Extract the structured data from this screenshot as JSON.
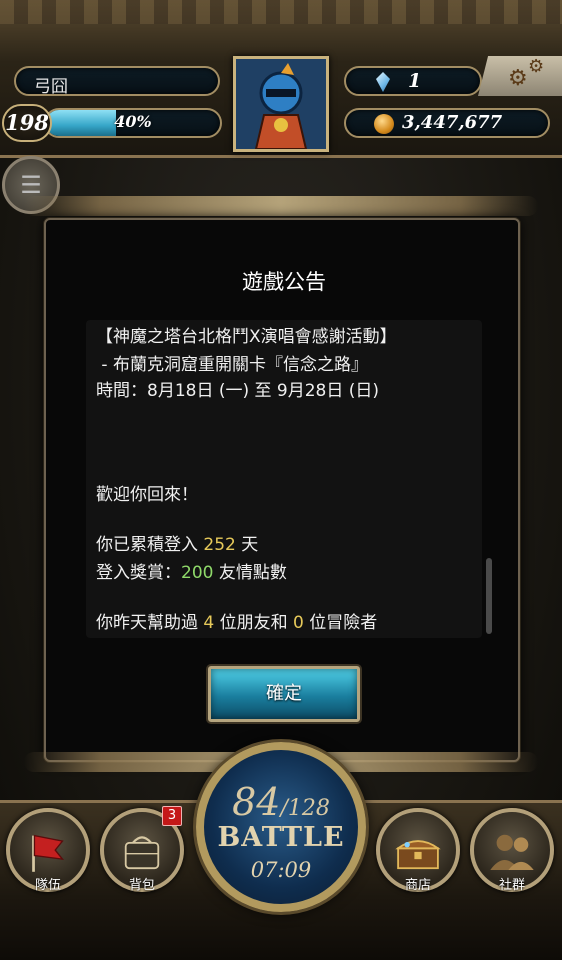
{
  "player": {
    "name": "弓囧",
    "level": "198",
    "exp_percent_label": "40%",
    "exp_fraction": 0.4,
    "gems": "1",
    "gold": "3,447,677"
  },
  "icons": {
    "settings": "gears-icon",
    "tab": "notice-tab-icon",
    "gem": "diamond-icon",
    "gold": "coin-icon"
  },
  "dialog": {
    "title": "遊戲公告",
    "lines": {
      "l1": "【神魔之塔台北格鬥X演唱會感謝活動】",
      "l2": " - 布蘭克洞窟重開關卡『信念之路』",
      "l3": "時間：8月18日 (一) 至 9月28日 (日)",
      "l4": "歡迎你回來！",
      "l5_prefix": "你已累積登入 ",
      "l5_value": "252",
      "l5_suffix": " 天",
      "l6_prefix": "登入獎賞：",
      "l6_value": "200",
      "l6_suffix": " 友情點數",
      "l7_prefix": "你昨天幫助過 ",
      "l7_value1": "4",
      "l7_mid": " 位朋友和 ",
      "l7_value2": "0",
      "l7_suffix": " 位冒險者"
    },
    "ok_label": "確定"
  },
  "nav": {
    "team": "隊伍",
    "bag": "背包",
    "bag_badge": "3",
    "shop": "商店",
    "social": "社群",
    "stamina_current": "84",
    "stamina_max": "/128",
    "battle": "BATTLE",
    "timer": "07:09"
  },
  "colors": {
    "highlight_yellow": "#e6c95a",
    "highlight_green": "#8fd96a",
    "button_cyan": "#1a7e9e",
    "badge_red": "#c41818"
  }
}
